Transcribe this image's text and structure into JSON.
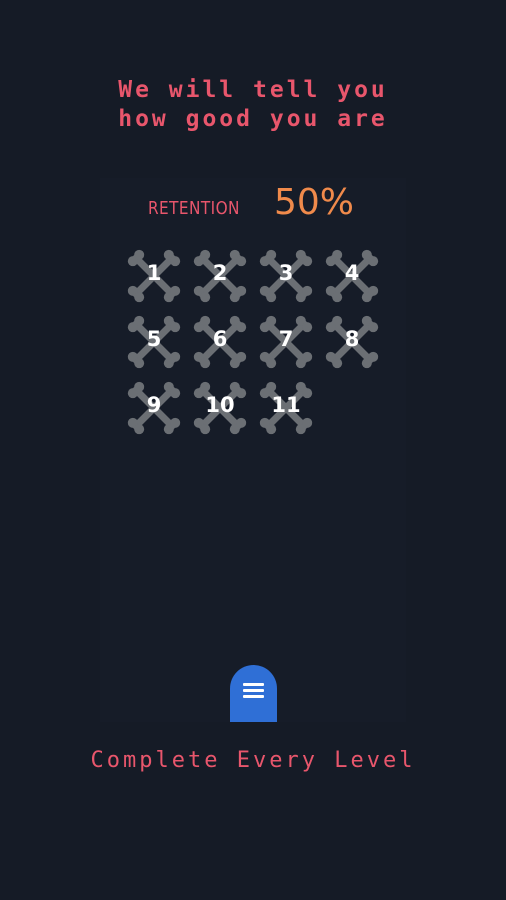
{
  "header": {
    "line1": "We will tell you",
    "line2": "how good you are"
  },
  "stats": {
    "retention_label": "RETENTION",
    "retention_value": "50%"
  },
  "levels": [
    "1",
    "2",
    "3",
    "4",
    "5",
    "6",
    "7",
    "8",
    "9",
    "10",
    "11"
  ],
  "footer": {
    "text": "Complete Every Level"
  },
  "icons": {
    "level_tile": "crossbones-icon",
    "menu": "hamburger-menu-icon"
  },
  "colors": {
    "background": "#151b26",
    "accent_text": "#e8566c",
    "retention_value": "#f08a4b",
    "bone": "#6b6f74",
    "menu_button": "#2f6fd6"
  }
}
